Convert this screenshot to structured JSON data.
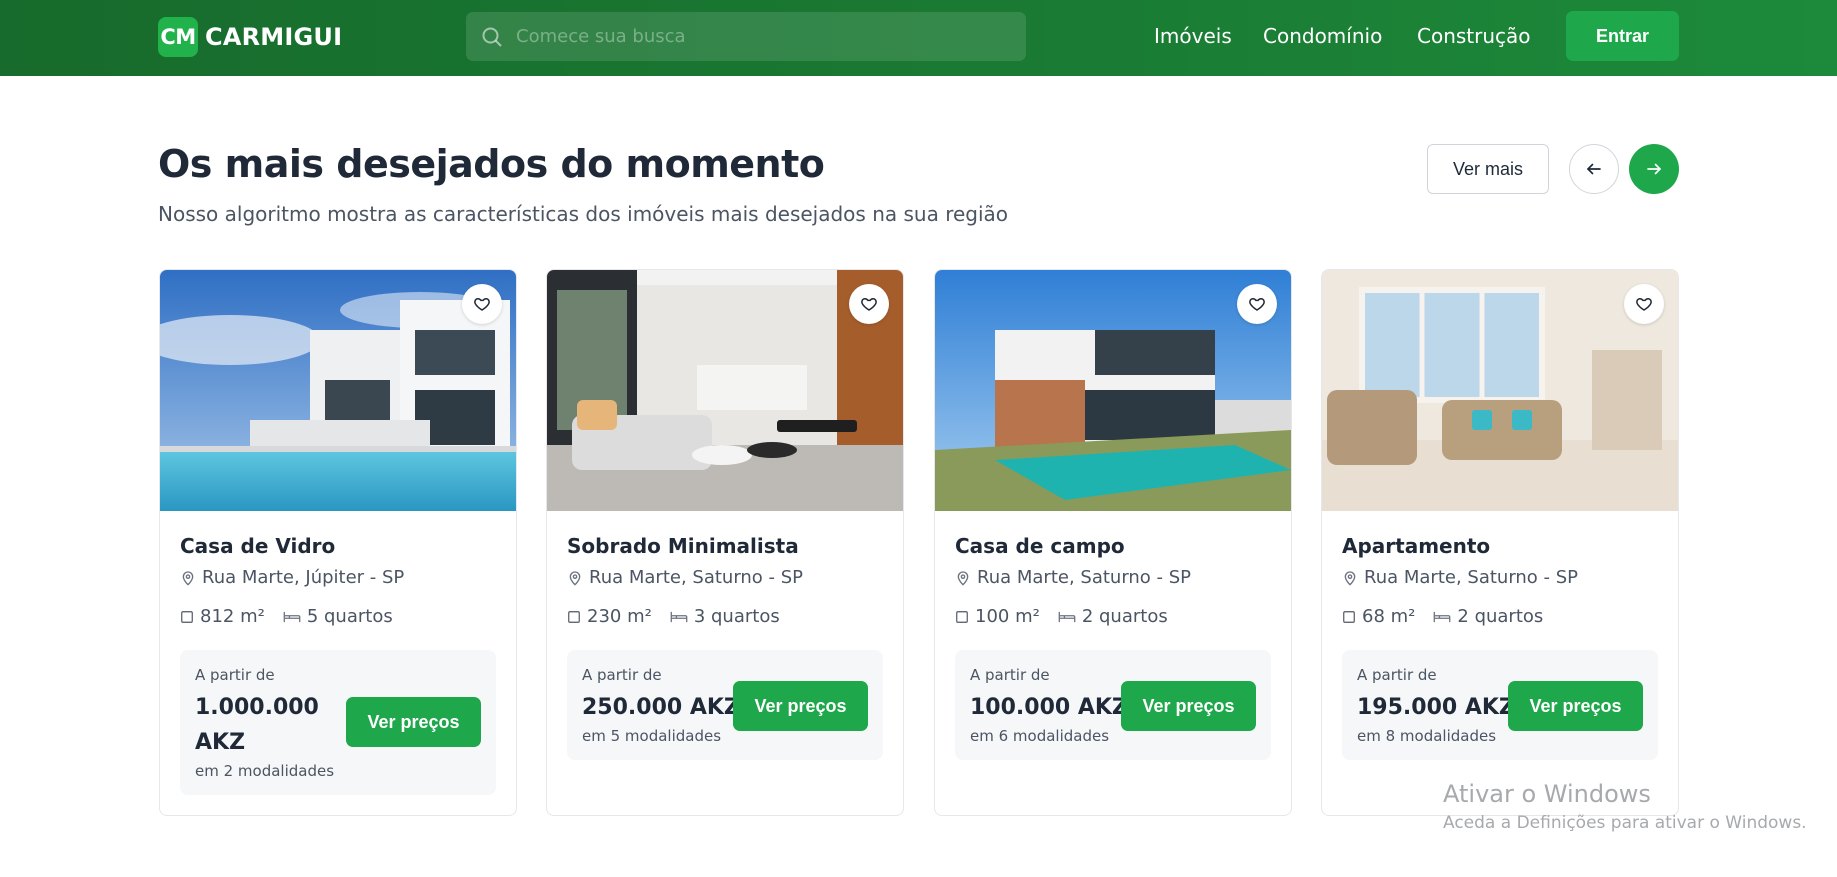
{
  "header": {
    "logo_mark": "CM",
    "logo_text": "CARMIGUI",
    "search_placeholder": "Comece sua busca",
    "nav": [
      "Imóveis",
      "Condomínio",
      "Construção"
    ],
    "login_label": "Entrar"
  },
  "section": {
    "title": "Os mais desejados do momento",
    "subtitle": "Nosso algoritmo mostra as características dos imóveis mais desejados na sua região",
    "see_more_label": "Ver mais",
    "prev_icon": "arrow-left-icon",
    "next_icon": "arrow-right-icon"
  },
  "cards": [
    {
      "title": "Casa de Vidro",
      "address": "Rua Marte, Júpiter - SP",
      "area": "812 m²",
      "rooms": "5 quartos",
      "price_label": "A partir de",
      "price": "1.000.000 AKZ",
      "price_line1": "1.000.000",
      "price_line2": "AKZ",
      "modalities": "em 2 modalidades",
      "button_label": "Ver preços"
    },
    {
      "title": "Sobrado Minimalista",
      "address": "Rua Marte, Saturno - SP",
      "area": "230 m²",
      "rooms": "3 quartos",
      "price_label": "A partir de",
      "price": "250.000 AKZ",
      "modalities": "em 5 modalidades",
      "button_label": "Ver preços"
    },
    {
      "title": "Casa de campo",
      "address": "Rua Marte, Saturno - SP",
      "area": "100 m²",
      "rooms": "2 quartos",
      "price_label": "A partir de",
      "price": "100.000 AKZ",
      "modalities": "em 6 modalidades",
      "button_label": "Ver preços"
    },
    {
      "title": "Apartamento",
      "address": "Rua Marte, Saturno - SP",
      "area": "68 m²",
      "rooms": "2 quartos",
      "price_label": "A partir de",
      "price": "195.000 AKZ",
      "modalities": "em 8 modalidades",
      "button_label": "Ver preços"
    }
  ],
  "watermark": {
    "title": "Ativar o Windows",
    "subtitle": "Aceda a Definições para ativar o Windows."
  },
  "colors": {
    "header_green": "#1a7a33",
    "accent_green": "#1ea84b",
    "text_dark": "#1f2937",
    "text_muted": "#4b5563"
  }
}
